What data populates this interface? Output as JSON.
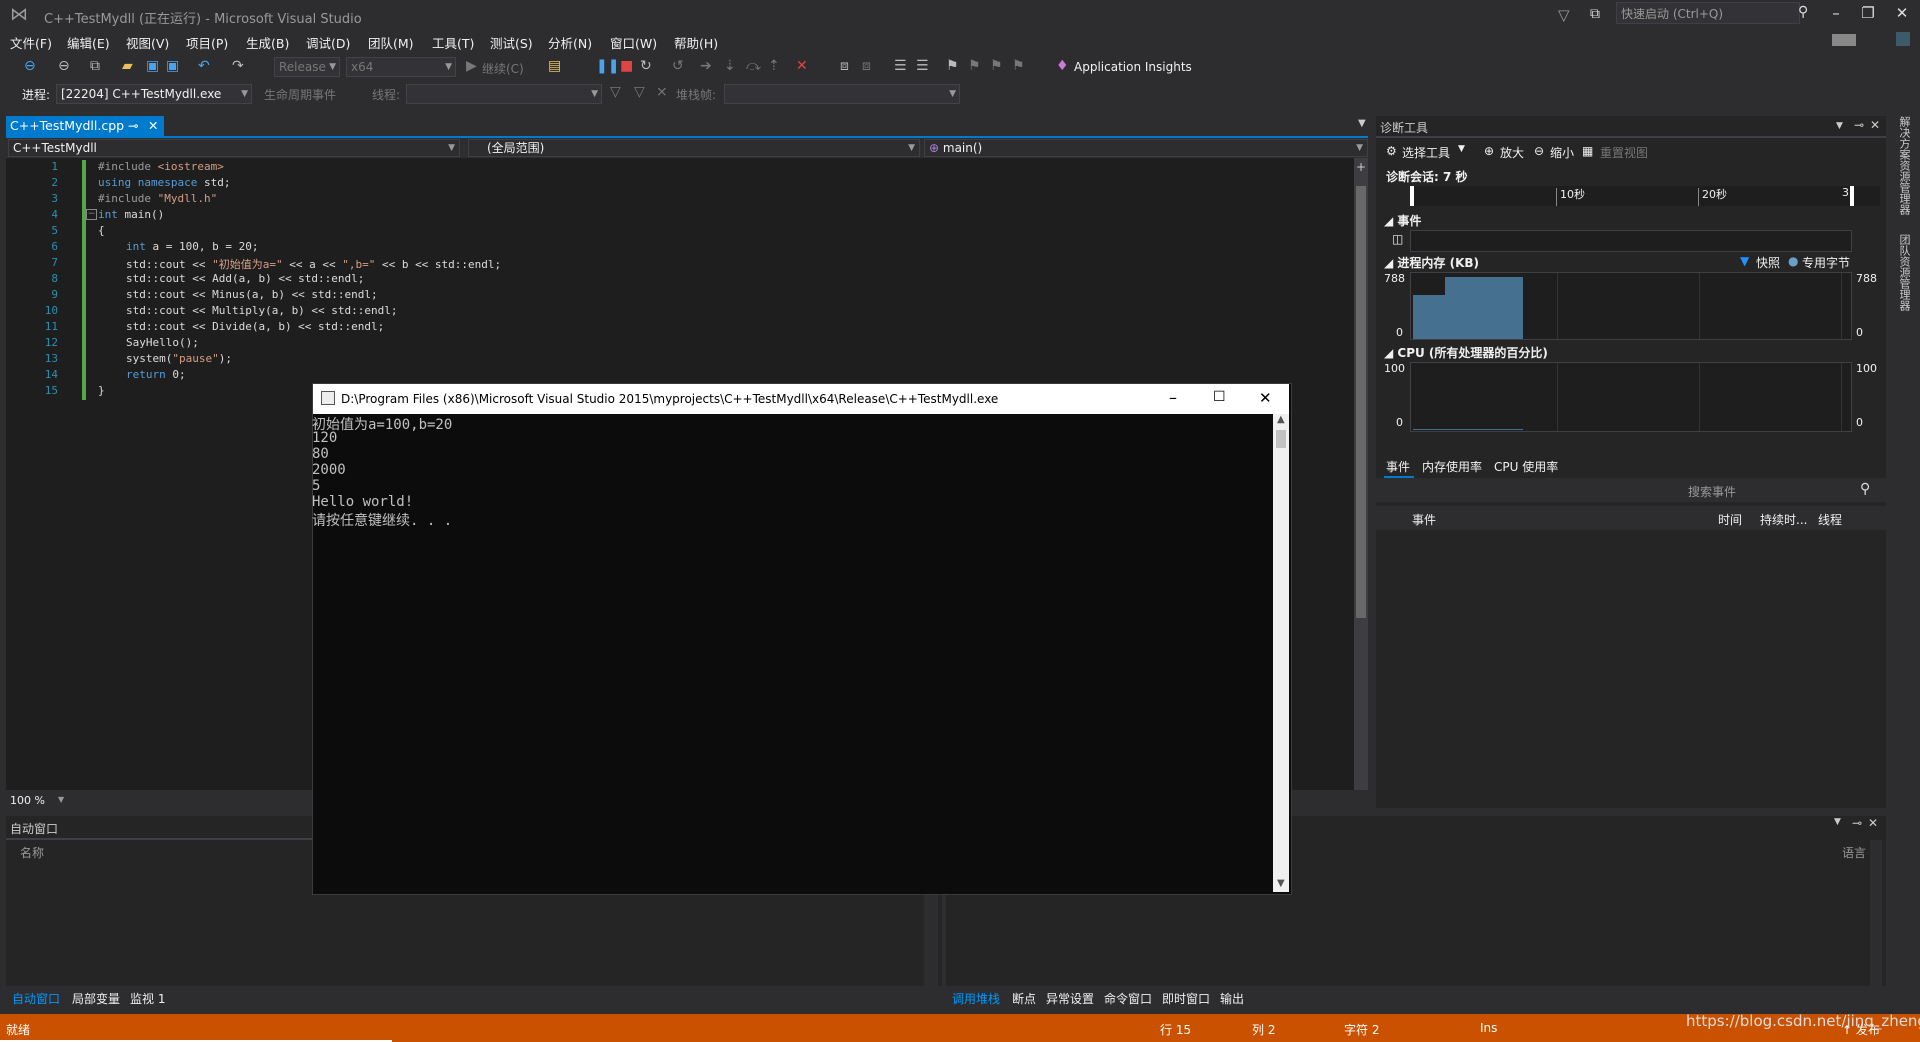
{
  "window": {
    "title": "C++TestMydll (正在运行) - Microsoft Visual Studio",
    "quick_launch": "快速启动 (Ctrl+Q)"
  },
  "menu": [
    "文件(F)",
    "编辑(E)",
    "视图(V)",
    "项目(P)",
    "生成(B)",
    "调试(D)",
    "团队(M)",
    "工具(T)",
    "测试(S)",
    "分析(N)",
    "窗口(W)",
    "帮助(H)"
  ],
  "toolbar": {
    "config": "Release",
    "platform": "x64",
    "continue": "继续(C)",
    "app_insights": "Application Insights"
  },
  "toolbar2": {
    "process_label": "进程:",
    "process_value": "[22204] C++TestMydll.exe",
    "lifecycle": "生命周期事件",
    "thread_label": "线程:",
    "stackframe_label": "堆栈帧:"
  },
  "editor": {
    "tab": "C++TestMydll.cpp",
    "nav_project": "C++TestMydll",
    "nav_scope": "(全局范围)",
    "nav_func": "main()",
    "zoom": "100 %",
    "line_numbers": [
      "1",
      "2",
      "3",
      "4",
      "5",
      "6",
      "7",
      "8",
      "9",
      "10",
      "11",
      "12",
      "13",
      "14",
      "15"
    ]
  },
  "code": {
    "l1a": "#include ",
    "l1b": "<iostream>",
    "l2a": "using namespace",
    "l2b": " std;",
    "l3a": "#include ",
    "l3b": "\"Mydll.h\"",
    "l4a": "int",
    "l4b": " main()",
    "l5": "{",
    "l6a": "int",
    "l6b": " a = 100, b = 20;",
    "l7a": "std::cout << ",
    "l7b": "\"初始值为a=\"",
    "l7c": " << a << ",
    "l7d": "\",b=\"",
    "l7e": " << b << std::endl;",
    "l8": "std::cout << Add(a, b) << std::endl;",
    "l9": "std::cout << Minus(a, b) << std::endl;",
    "l10": "std::cout << Multiply(a, b) << std::endl;",
    "l11": "std::cout << Divide(a, b) << std::endl;",
    "l12": "SayHello();",
    "l13a": "system(",
    "l13b": "\"pause\"",
    "l13c": ");",
    "l14a": "return",
    "l14b": " 0;",
    "l15": "}"
  },
  "diagnostics": {
    "title": "诊断工具",
    "select_tool": "选择工具",
    "zoom_in": "放大",
    "zoom_out": "缩小",
    "reset_view": "重置视图",
    "session": "诊断会话: 7 秒",
    "ruler_ticks": [
      "10秒",
      "20秒",
      "3"
    ],
    "events": "事件",
    "memory": "进程内存 (KB)",
    "legend_snapshot": "快照",
    "legend_private": "专用字节",
    "mem_max": "788",
    "mem_min": "0",
    "cpu": "CPU (所有处理器的百分比)",
    "cpu_max": "100",
    "cpu_min": "0",
    "tabs": [
      "事件",
      "内存使用率",
      "CPU 使用率"
    ],
    "search_events": "搜索事件",
    "columns": [
      "事件",
      "时间",
      "持续时...",
      "线程"
    ]
  },
  "right_rail": [
    "解决方案资源管理器",
    "团队资源管理器"
  ],
  "bottom": {
    "left_title": "自动窗口",
    "left_col_name": "名称",
    "right_col_lang": "语言",
    "left_tabs": [
      "自动窗口",
      "局部变量",
      "监视 1"
    ],
    "right_tabs": [
      "调用堆栈",
      "断点",
      "异常设置",
      "命令窗口",
      "即时窗口",
      "输出"
    ]
  },
  "status": {
    "ready": "就绪",
    "line": "行 15",
    "col": "列 2",
    "char": "字符 2",
    "ins": "Ins",
    "publish": "↑ 发布"
  },
  "console": {
    "title": "D:\\Program Files (x86)\\Microsoft Visual Studio 2015\\myprojects\\C++TestMydll\\x64\\Release\\C++TestMydll.exe",
    "lines": [
      "初始值为a=100,b=20",
      "120",
      "80",
      "2000",
      "5",
      "Hello world!",
      "请按任意键继续. . ."
    ]
  },
  "watermark": "https://blog.csdn.net/jinq_zheng",
  "colors": {
    "accent": "#007acc",
    "status": "#ca5100",
    "memory_fill": "#45708f"
  }
}
